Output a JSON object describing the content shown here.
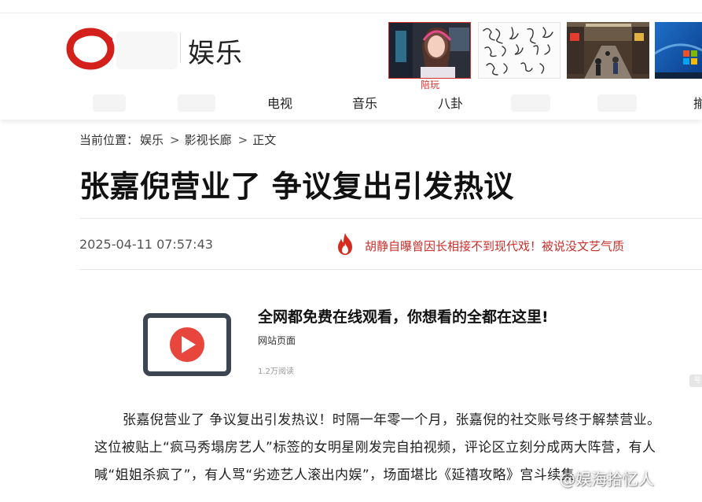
{
  "header": {
    "channel_title": "娱乐",
    "thumbnails": [
      {
        "label": "陪玩",
        "icon": "streamer-photo"
      },
      {
        "label": "",
        "icon": "calligraphy-photo"
      },
      {
        "label": "",
        "icon": "street-photo"
      },
      {
        "label": "",
        "icon": "windows-desktop-photo"
      }
    ],
    "nav": [
      "电视",
      "音乐",
      "八卦"
    ],
    "nav_edge": "揃"
  },
  "breadcrumb": {
    "prefix": "当前位置：",
    "items": [
      "娱乐",
      "影视长廊",
      "正文"
    ],
    "separator": ">"
  },
  "article": {
    "title": "张嘉倪营业了 争议复出引发热议",
    "date": "2025-04-11 07:57:43",
    "hot_link": "胡静自曝曾因长相接不到现代戏！被说没文艺气质",
    "paragraphs": [
      "张嘉倪营业了 争议复出引发热议！时隔一年零一个月，张嘉倪的社交账号终于解禁营业。",
      "这位被贴上“疯马秀塌房艺人”标签的女明星刚发完自拍视频，评论区立刻分成两大阵营，有人",
      "喊“姐姐杀疯了”，有人骂“劣迹艺人滚出内娱”，场面堪比《延禧攻略》宫斗续集"
    ]
  },
  "promo": {
    "title": "全网都免费在线观看，你想看的全都在这里!",
    "source": "网站页面",
    "views": "1.2万阅读",
    "side_tab": "号"
  },
  "watermark": "@娱海拾忆人",
  "colors": {
    "accent_red": "#c9302c",
    "logo_red": "#d3201a",
    "promo_icon_dark": "#3c4650",
    "play_red": "#e8453c"
  }
}
